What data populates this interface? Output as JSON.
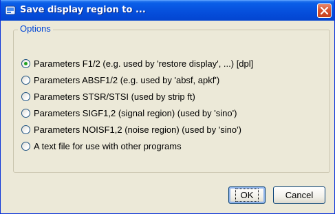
{
  "window": {
    "title": "Save display region to ...",
    "accent": "#0754e0",
    "close_color": "#d8532f"
  },
  "group": {
    "legend": "Options"
  },
  "options": [
    {
      "label": "Parameters F1/2 (e.g. used by 'restore display', ...) [dpl]",
      "checked": true
    },
    {
      "label": "Parameters ABSF1/2 (e.g. used by 'absf, apkf')",
      "checked": false
    },
    {
      "label": "Parameters STSR/STSI (used by strip ft)",
      "checked": false
    },
    {
      "label": "Parameters SIGF1,2 (signal region) (used by 'sino')",
      "checked": false
    },
    {
      "label": "Parameters NOISF1,2 (noise region) (used by 'sino')",
      "checked": false
    },
    {
      "label": "A text file for use with other programs",
      "checked": false
    }
  ],
  "buttons": {
    "ok_label": "OK",
    "cancel_label": "Cancel"
  },
  "icons": {
    "title_icon": "app-window-icon",
    "close_icon": "close-icon"
  }
}
